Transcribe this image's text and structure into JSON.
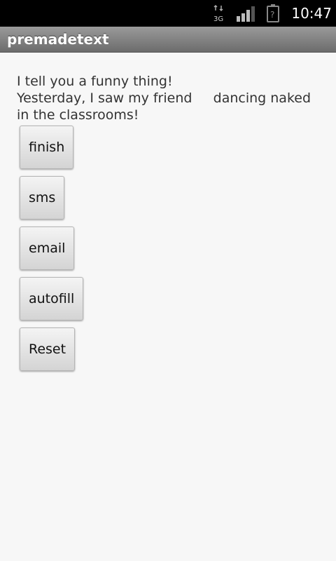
{
  "status_bar": {
    "time": "10:47",
    "network_label": "3G",
    "network_icon": "3g-data-icon",
    "signal_icon": "signal-strength-icon",
    "battery_icon": "battery-unknown-icon"
  },
  "title_bar": {
    "title": "premadetext"
  },
  "content": {
    "story": "I tell you a funny thing!\nYesterday, I saw my friend     dancing naked in the classrooms!"
  },
  "buttons": {
    "finish": "finish",
    "sms": "sms",
    "email": "email",
    "autofill": "autofill",
    "reset": "Reset"
  }
}
